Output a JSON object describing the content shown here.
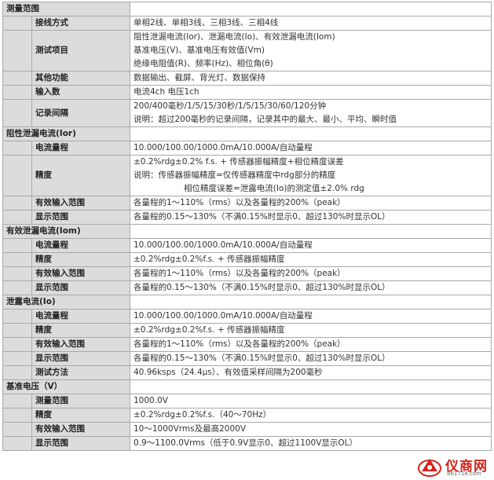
{
  "sections": [
    {
      "title": "测量范围",
      "rows": [
        {
          "label": "接线方式",
          "lines": [
            "单相2线、单相3线、三相3线、三相4线"
          ]
        },
        {
          "label": "测试项目",
          "lines": [
            "阻性泄漏电流(Ior)、泄漏电流(Io)、有效泄漏电流(Iom)",
            "基准电压(V)、基准电压有效值(Vm)",
            "绝缘电阻值(R)、频率(Hz)、相位角(θ)"
          ]
        },
        {
          "label": "其他功能",
          "lines": [
            "数据输出、截屏、背光灯、数据保持"
          ]
        },
        {
          "label": "输入数",
          "lines": [
            "电流4ch 电压1ch"
          ]
        },
        {
          "label": "记录间隔",
          "lines": [
            "200/400毫秒/1/5/15/30秒/1/5/15/30/60/120分钟",
            "说明：超过200毫秒的记录间隔，记录其中的最大、最小、平均、瞬时值"
          ]
        }
      ]
    },
    {
      "title": "阻性泄漏电流(Ior)",
      "rows": [
        {
          "label": "电流量程",
          "lines": [
            "10.000/100.00/1000.0mA/10.000A/自动量程"
          ]
        },
        {
          "label": "精度",
          "lines": [
            "±0.2%rdg±0.2% f.s. + 传感器振幅精度+相位精度误差",
            "说明：传感器振幅精度=仅传感器精度中rdg部分的精度",
            "相位精度误差=泄露电流(Io)的测定值±2.0% rdg"
          ]
        },
        {
          "label": "有效输入范围",
          "lines": [
            "各量程的1～110%（rms）以及各量程的200%（peak）"
          ]
        },
        {
          "label": "显示范围",
          "lines": [
            "各量程的0.15～130%（不满0.15%时显示0、超过130%时显示OL）"
          ]
        }
      ]
    },
    {
      "title": "有效泄漏电流(Iom)",
      "rows": [
        {
          "label": "电流量程",
          "lines": [
            "10.000/100.00/1000.0mA/10.000A/自动量程"
          ]
        },
        {
          "label": "精度",
          "lines": [
            "±0.2%rdg±0.2%f.s. + 传感器振幅精度"
          ]
        },
        {
          "label": "有效输入范围",
          "lines": [
            "各量程的1～110%（rms）以及各量程的200%（peak）"
          ]
        },
        {
          "label": "显示范围",
          "lines": [
            "各量程的0.15～130%（不满0.15%时显示0、超过130%时显示OL）"
          ]
        }
      ]
    },
    {
      "title": "泄露电流(Io)",
      "rows": [
        {
          "label": "电流量程",
          "lines": [
            "10.000/100.00/1000.0mA/10.000A/自动量程"
          ]
        },
        {
          "label": "精度",
          "lines": [
            "±0.2%rdg±0.2%f.s. + 传感器振幅精度"
          ]
        },
        {
          "label": "有效输入范围",
          "lines": [
            "各量程的1～110%（rms）以及各量程的200%（peak）"
          ]
        },
        {
          "label": "显示范围",
          "lines": [
            "各量程的0.15～130%（不满0.15%时显示0、超过130%时显示OL）"
          ]
        },
        {
          "label": "测试方法",
          "lines": [
            "40.96ksps（24.4μs）、有效值采样间隔为200毫秒"
          ]
        }
      ]
    },
    {
      "title": "基准电压（V）",
      "rows": [
        {
          "label": "测量范围",
          "lines": [
            "1000.0V"
          ]
        },
        {
          "label": "精度",
          "lines": [
            "±0.2%rdg±0.2%f.s.（40～70Hz）"
          ]
        },
        {
          "label": "有效输入范围",
          "lines": [
            "10～1000Vrms及最高2000V"
          ]
        },
        {
          "label": "显示范围",
          "lines": [
            "0.9～1100.0Vrms（低于0.9V显示0、超过1100V显示OL）"
          ]
        }
      ]
    }
  ],
  "watermark": {
    "name": "仪商网",
    "url": "861718.com",
    "color": "#d4231a"
  }
}
